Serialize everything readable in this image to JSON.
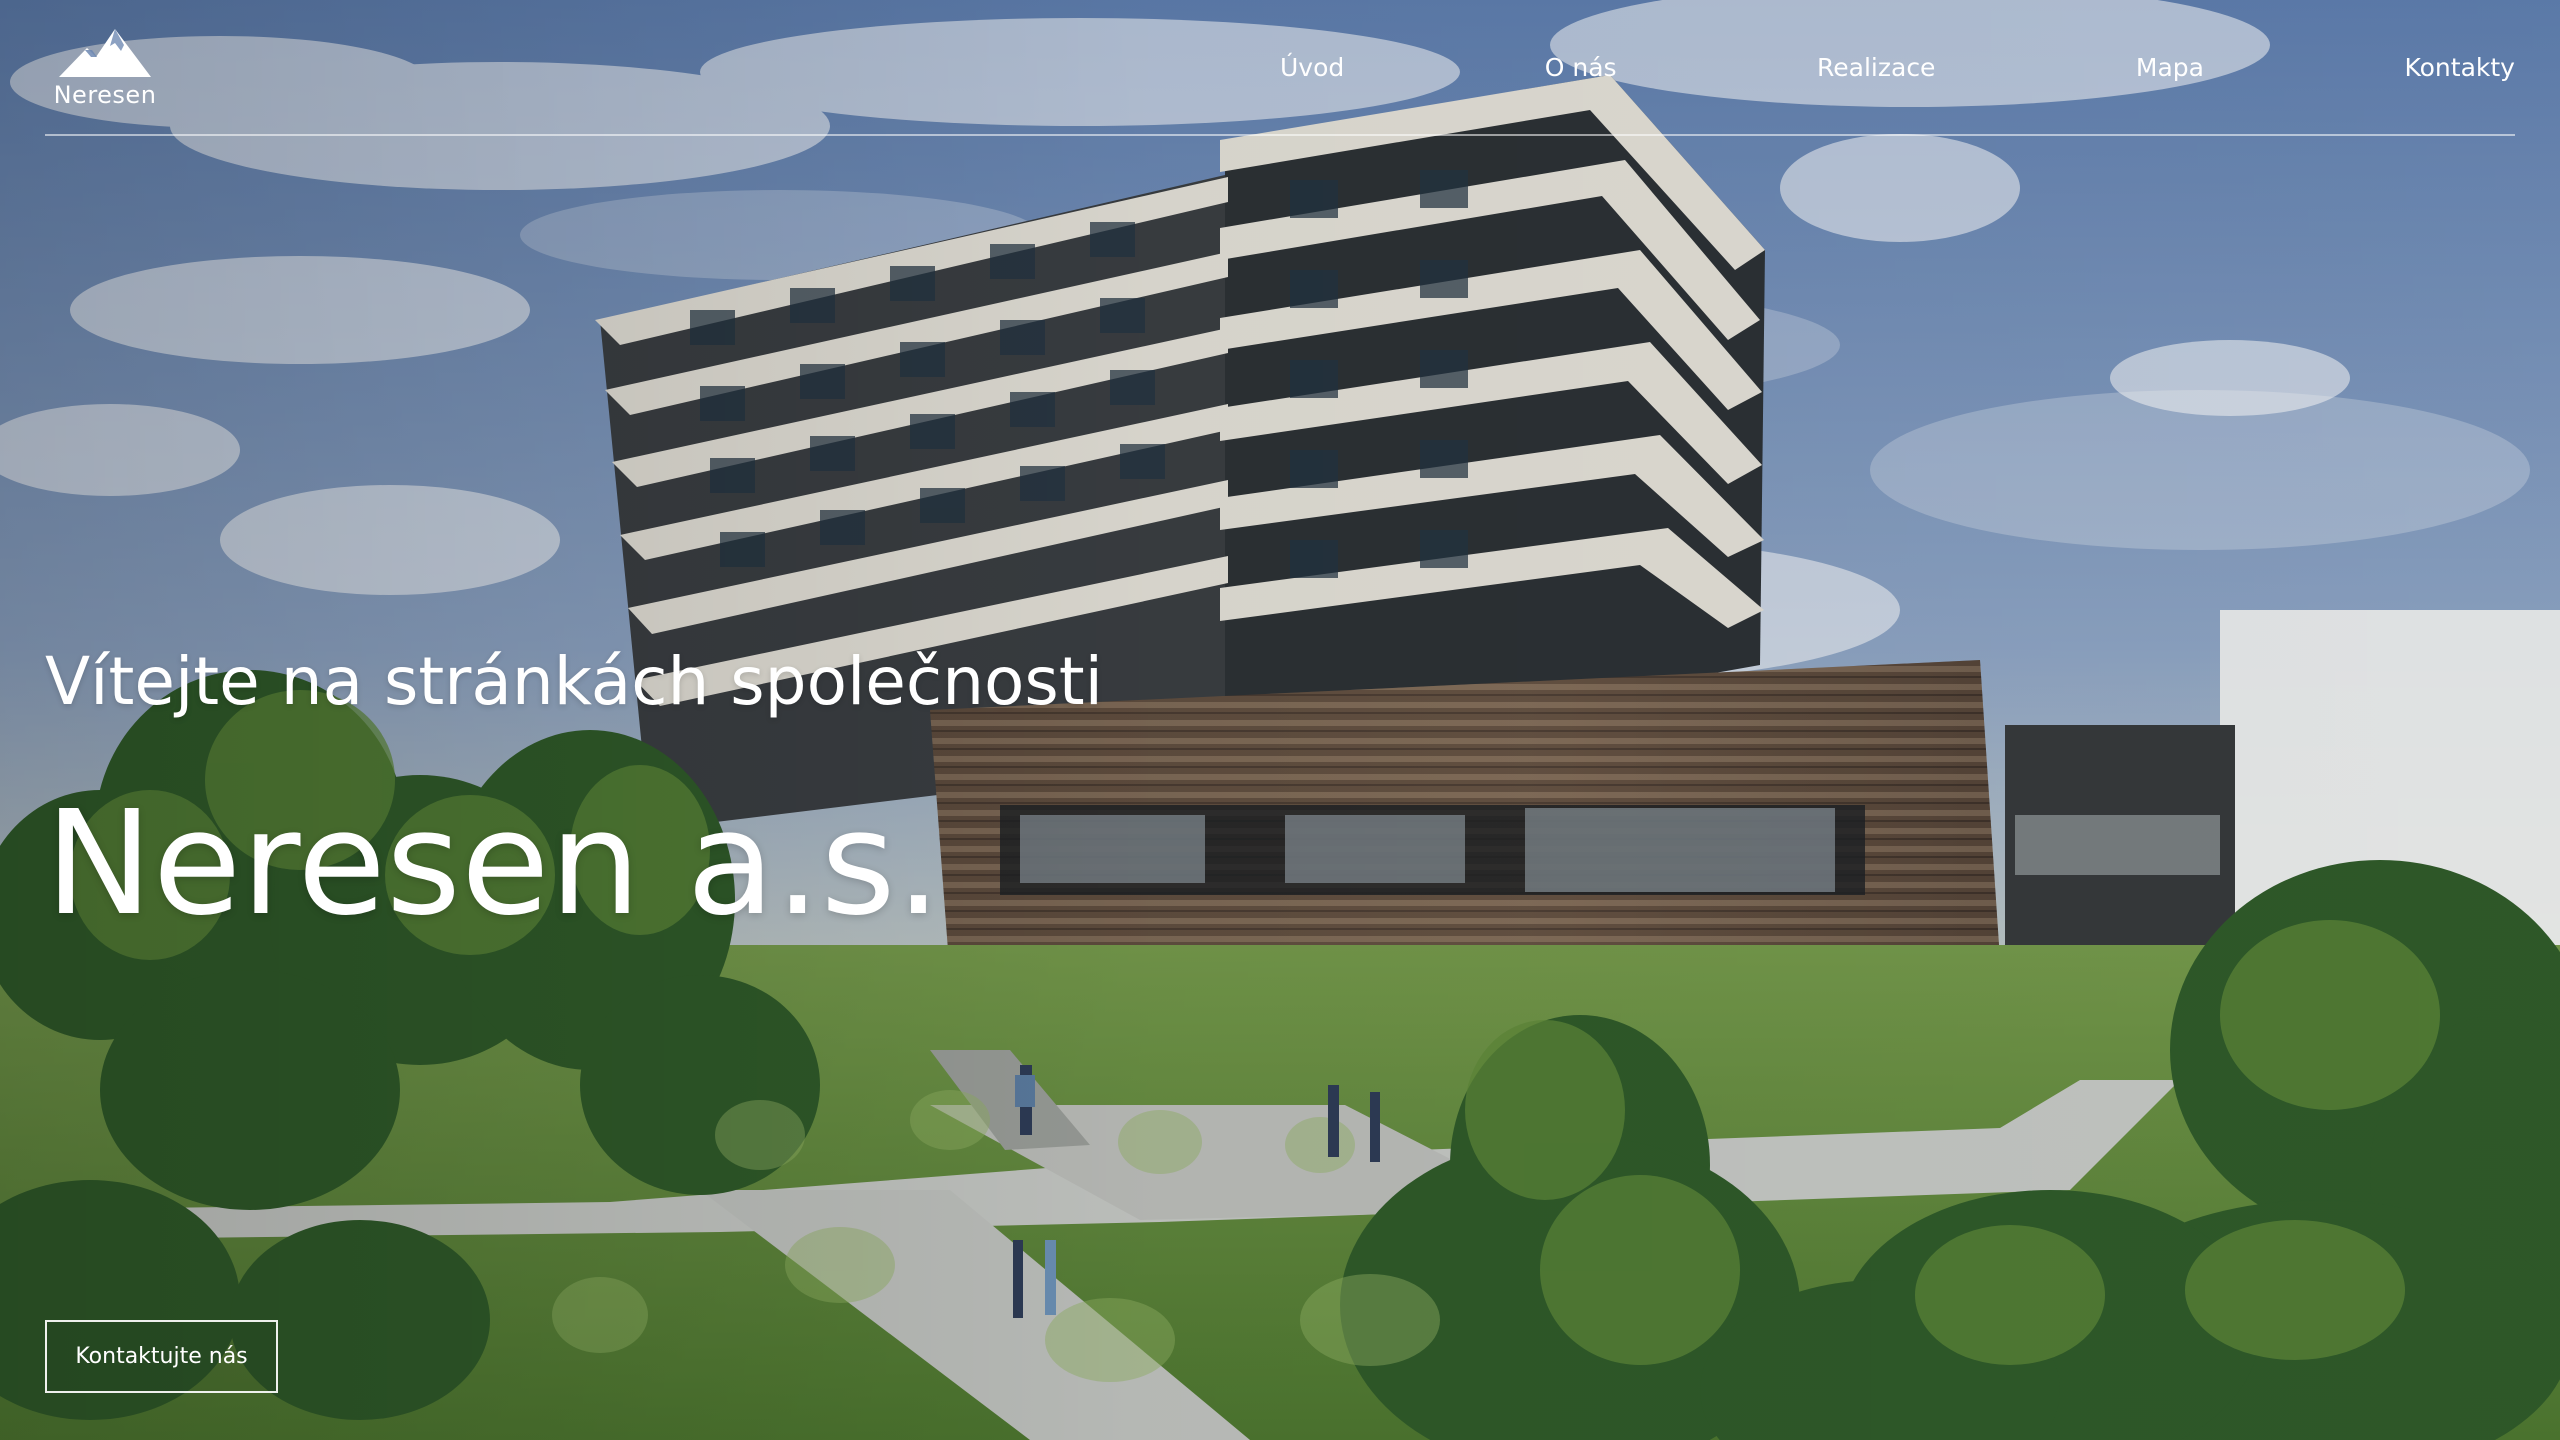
{
  "page": {
    "brand": "Neresen",
    "logo_icon": "mountain-icon",
    "navigation": [
      {
        "label": "Úvod"
      },
      {
        "label": "O nás"
      },
      {
        "label": "Realizace"
      },
      {
        "label": "Mapa"
      },
      {
        "label": "Kontakty"
      }
    ],
    "hero": {
      "welcome": "Vítejte na stránkách společnosti",
      "company": "Neresen a.s.",
      "cta": "Kontaktujte nás"
    }
  },
  "colors": {
    "text": "#ffffff",
    "sky": "#6f8bb3",
    "foliage": "#4f7f35",
    "facade": "#6b5441"
  }
}
